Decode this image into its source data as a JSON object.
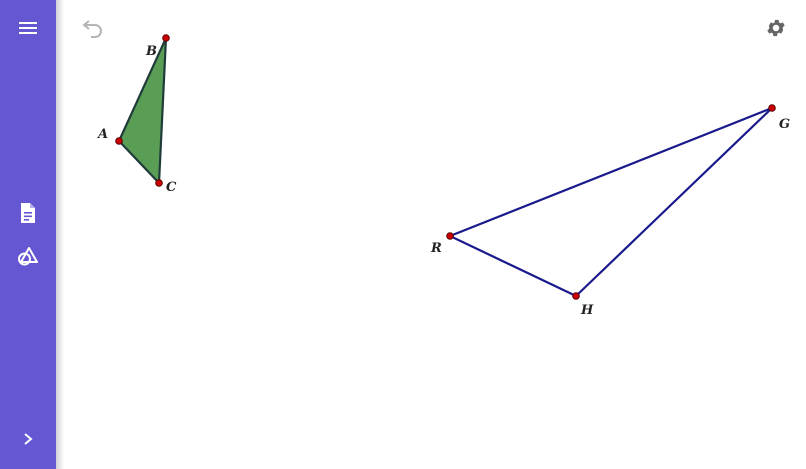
{
  "app": {
    "accent_color": "#6557d2"
  },
  "sidebar": {
    "menu_icon": "hamburger-menu-icon",
    "items": [
      {
        "name": "algebra-view",
        "icon": "document-icon"
      },
      {
        "name": "tools",
        "icon": "shapes-tools-icon"
      }
    ],
    "expand_icon": "chevron-right-icon"
  },
  "toolbar": {
    "undo_icon": "undo-icon",
    "settings_icon": "gear-icon"
  },
  "geometry": {
    "triangle_ABC": {
      "fill_color": "#5a9e55",
      "stroke_color": "#1f3b3a",
      "points": [
        {
          "label": "A"
        },
        {
          "label": "B"
        },
        {
          "label": "C"
        }
      ]
    },
    "triangle_RGH": {
      "stroke_color": "#1a1a8c",
      "points": [
        {
          "label": "R"
        },
        {
          "label": "G"
        },
        {
          "label": "H"
        }
      ]
    },
    "point_color": "#cc0000"
  }
}
